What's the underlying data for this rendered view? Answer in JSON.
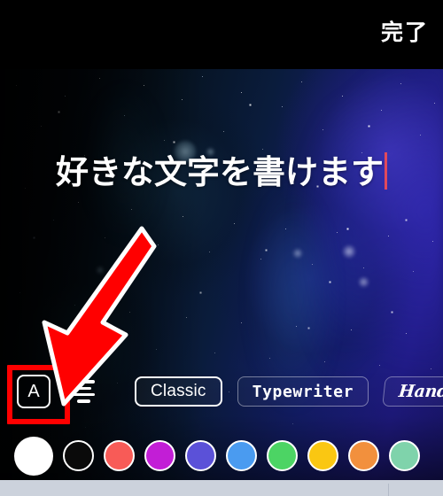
{
  "app": {
    "screen_name": "text-overlay-editor",
    "background_description": "starry night sky photo"
  },
  "topbar": {
    "done_label": "完了"
  },
  "canvas": {
    "overlay_text": "好きな文字を書けます",
    "caret_color": "#e0495c",
    "text_color": "#ffffff"
  },
  "annotation": {
    "arrow_color": "#ff0000",
    "arrow_outline_color": "#ffffff",
    "highlight_box_color": "#ff0000",
    "points_at": "letter-style-tool"
  },
  "toolbar": {
    "letter_tool_glyph": "A",
    "letter_tool_name": "text-style",
    "align_tool_name": "text-align-center",
    "fonts": [
      {
        "label": "Classic",
        "style": "sans",
        "selected": true
      },
      {
        "label": "Typewriter",
        "style": "mono",
        "selected": false
      },
      {
        "label": "Handwrit",
        "style": "script",
        "selected": false
      }
    ]
  },
  "colors": {
    "selected_index": 0,
    "swatches": [
      {
        "name": "white",
        "hex": "#ffffff",
        "selected": true
      },
      {
        "name": "black",
        "hex": "#0a0a0a",
        "selected": false
      },
      {
        "name": "red",
        "hex": "#f85b57",
        "selected": false
      },
      {
        "name": "magenta",
        "hex": "#c21ed6",
        "selected": false
      },
      {
        "name": "indigo",
        "hex": "#5b51d8",
        "selected": false
      },
      {
        "name": "blue",
        "hex": "#4a9bf0",
        "selected": false
      },
      {
        "name": "green",
        "hex": "#4cd464",
        "selected": false
      },
      {
        "name": "yellow",
        "hex": "#fac712",
        "selected": false
      },
      {
        "name": "orange",
        "hex": "#f2903d",
        "selected": false
      },
      {
        "name": "mint",
        "hex": "#7fd3ab",
        "selected": false
      }
    ]
  }
}
